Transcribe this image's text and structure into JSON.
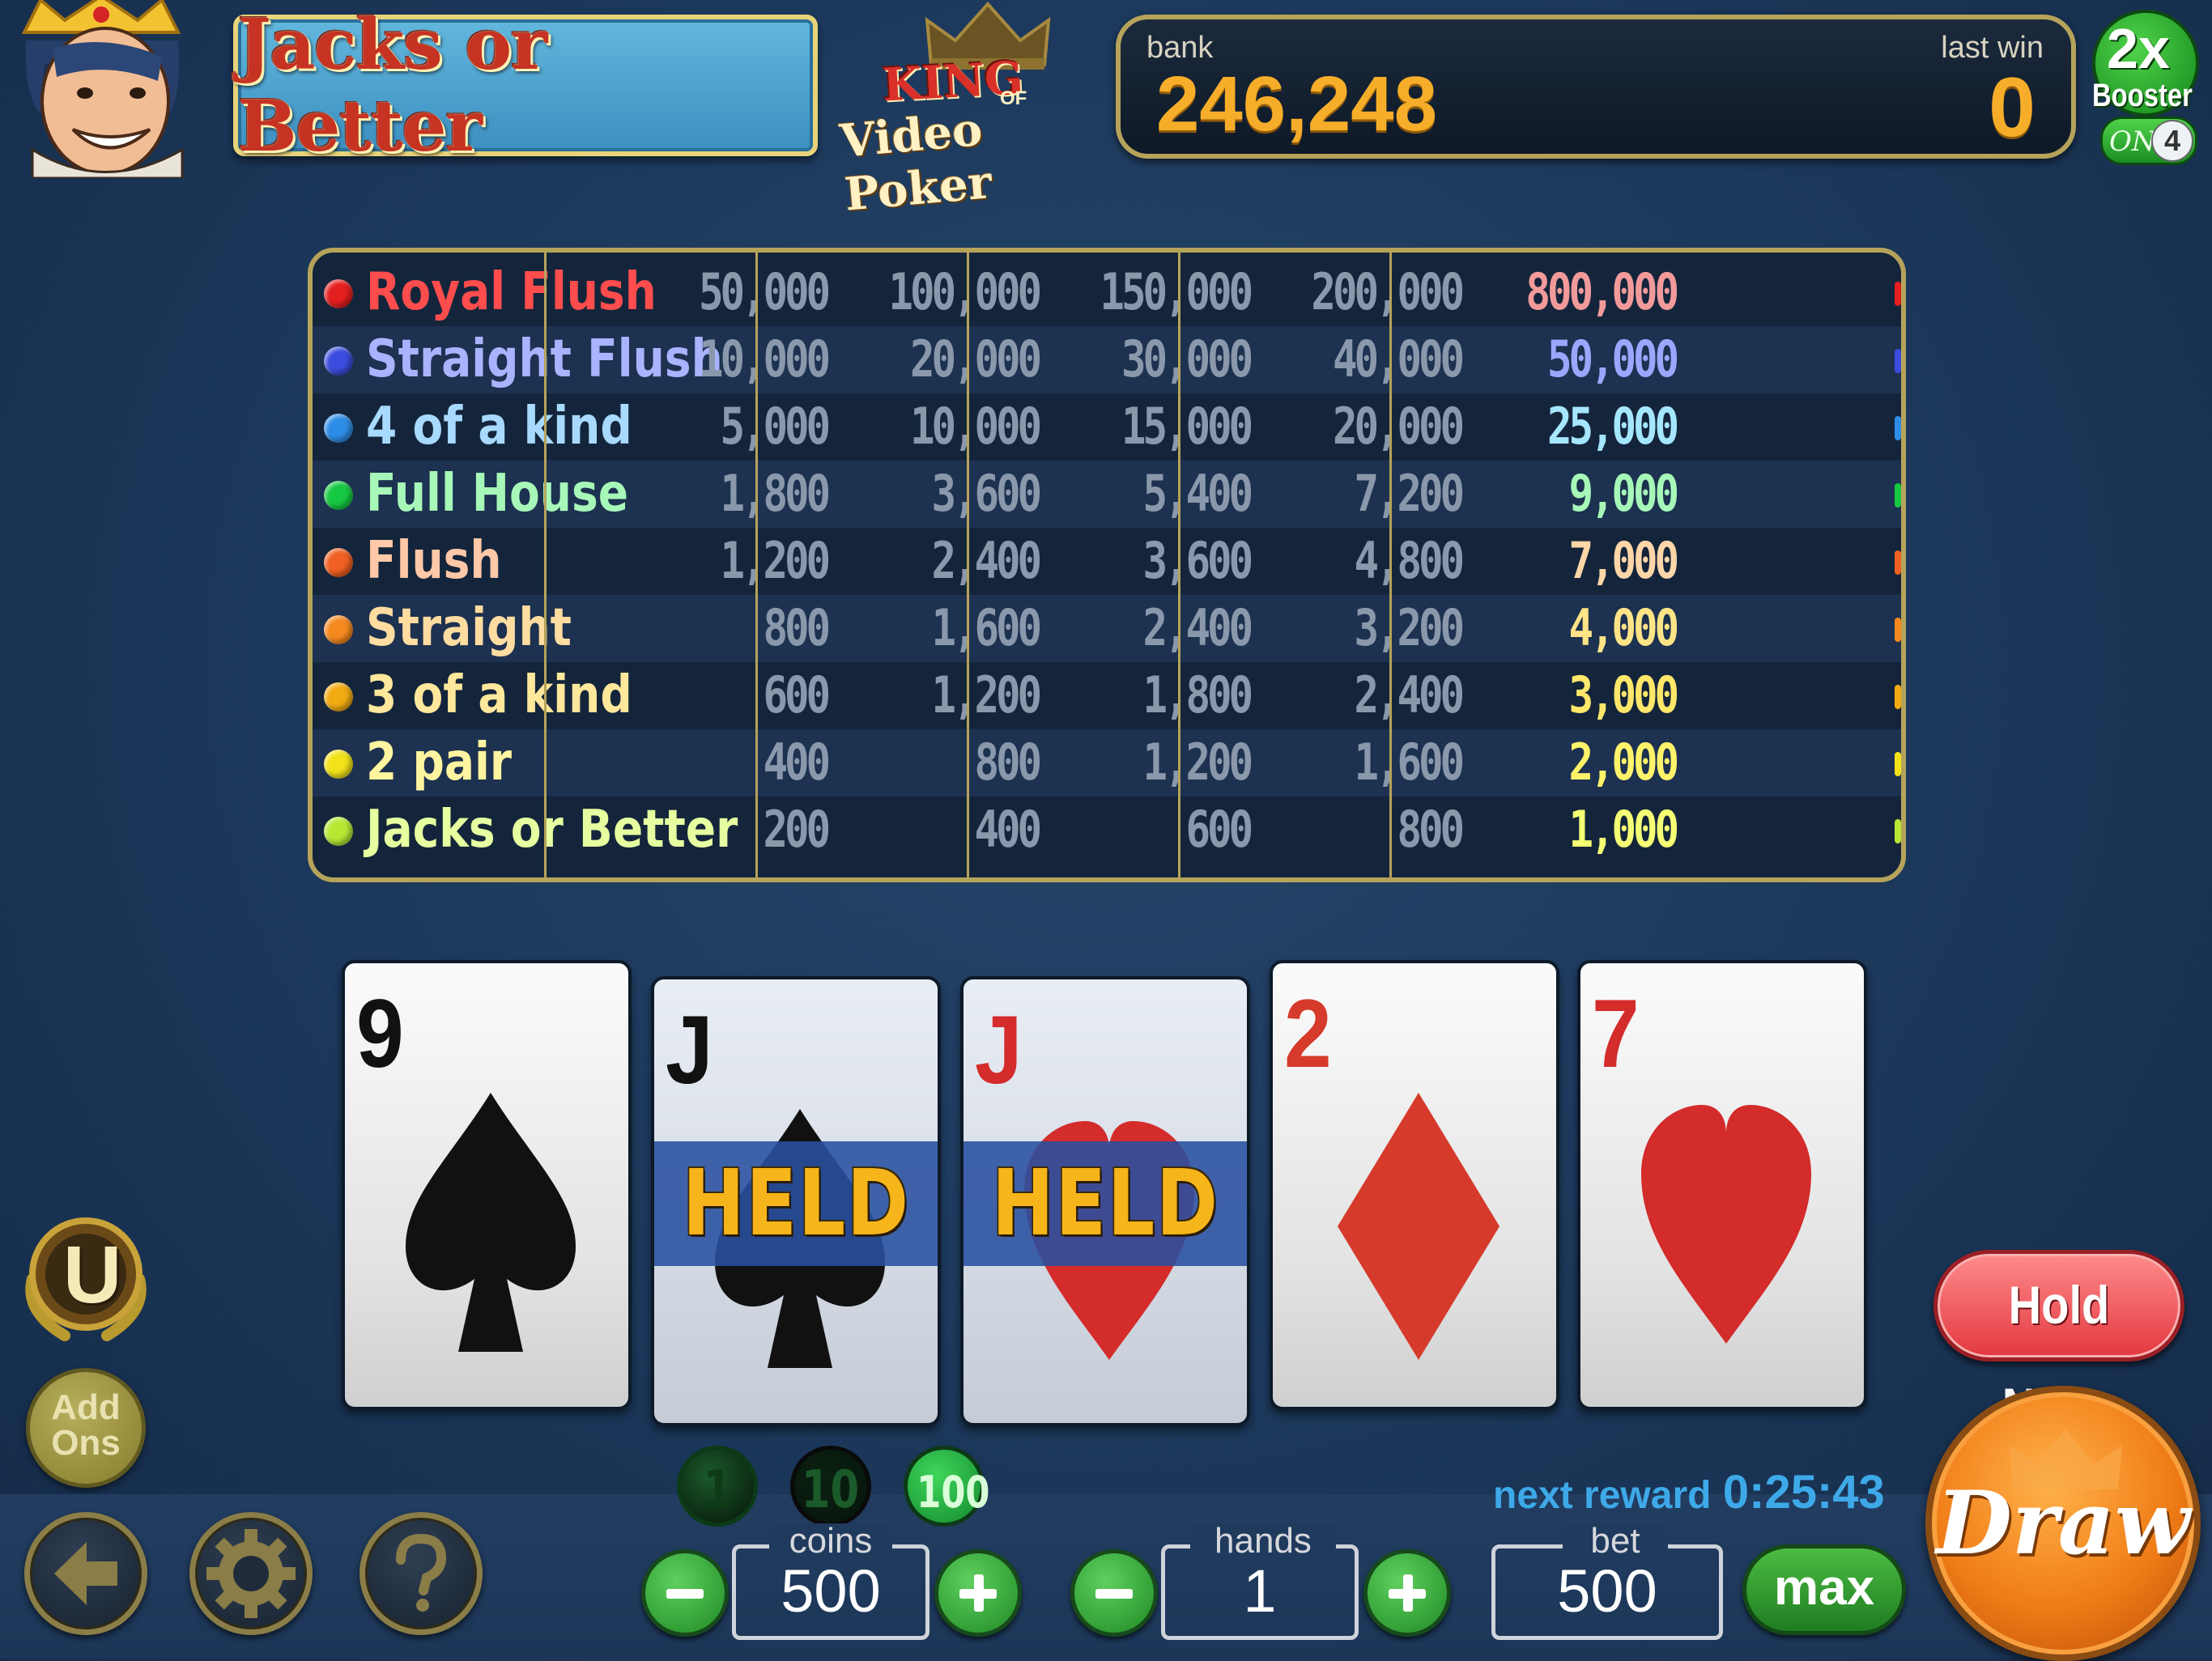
{
  "header": {
    "game_title": "Jacks or Better",
    "logo_line1": "KING",
    "logo_of": "OF",
    "logo_line2": "Video Poker",
    "bank_label": "bank",
    "bank_value": "246,248",
    "last_win_label": "last win",
    "last_win_value": "0",
    "booster_multiplier": "2x",
    "booster_label": "Booster",
    "booster_state": "ON",
    "booster_count": "4"
  },
  "paytable": {
    "rows": [
      {
        "hand": "Royal Flush",
        "color": "#ff4d4d",
        "dot": "#e41f1f",
        "values": [
          "50,000",
          "100,000",
          "150,000",
          "200,000",
          "800,000"
        ],
        "hi": "#f29a9a"
      },
      {
        "hand": "Straight Flush",
        "color": "#a9b3ff",
        "dot": "#3b4dde",
        "values": [
          "10,000",
          "20,000",
          "30,000",
          "40,000",
          "50,000"
        ],
        "hi": "#9ba7ff"
      },
      {
        "hand": "4 of a kind",
        "color": "#a8d9ff",
        "dot": "#2d8de6",
        "values": [
          "5,000",
          "10,000",
          "15,000",
          "20,000",
          "25,000"
        ],
        "hi": "#a5e6ff"
      },
      {
        "hand": "Full House",
        "color": "#a6f7b8",
        "dot": "#16c942",
        "values": [
          "1,800",
          "3,600",
          "5,400",
          "7,200",
          "9,000"
        ],
        "hi": "#a6f7b8"
      },
      {
        "hand": "Flush",
        "color": "#ffc8a8",
        "dot": "#f06022",
        "values": [
          "1,200",
          "2,400",
          "3,600",
          "4,800",
          "7,000"
        ],
        "hi": "#ffd6a8"
      },
      {
        "hand": "Straight",
        "color": "#ffdca0",
        "dot": "#f5891f",
        "values": [
          "800",
          "1,600",
          "2,400",
          "3,200",
          "4,000"
        ],
        "hi": "#ffe487"
      },
      {
        "hand": "3 of a kind",
        "color": "#ffe79b",
        "dot": "#f2aa12",
        "values": [
          "600",
          "1,200",
          "1,800",
          "2,400",
          "3,000"
        ],
        "hi": "#ffe76a"
      },
      {
        "hand": "2 pair",
        "color": "#fff5a0",
        "dot": "#f2e21a",
        "values": [
          "400",
          "800",
          "1,200",
          "1,600",
          "2,000"
        ],
        "hi": "#fff36a"
      },
      {
        "hand": "Jacks or Better",
        "color": "#e6ffa0",
        "dot": "#b6e834",
        "values": [
          "200",
          "400",
          "600",
          "800",
          "1,000"
        ],
        "hi": "#f5ff74"
      }
    ]
  },
  "cards": [
    {
      "rank": "9",
      "suit": "spade",
      "color": "#111111",
      "held": false
    },
    {
      "rank": "J",
      "suit": "spade",
      "color": "#111111",
      "held": true
    },
    {
      "rank": "J",
      "suit": "heart",
      "color": "#d42b2b",
      "held": true
    },
    {
      "rank": "2",
      "suit": "diamond",
      "color": "#d53a2a",
      "held": false
    },
    {
      "rank": "7",
      "suit": "heart",
      "color": "#d42b2b",
      "held": false
    }
  ],
  "held_label": "HELD",
  "side": {
    "u_badge_letter": "U",
    "addons_line1": "Add",
    "addons_line2": "Ons",
    "back_icon": "arrow-left-icon",
    "settings_icon": "gear-icon",
    "help_icon": "question-icon"
  },
  "chips": [
    {
      "value": "1",
      "color": "#1b5a2a",
      "text": "#0e3a18"
    },
    {
      "value": "10",
      "color": "#0b2011",
      "text": "#1b5a2a"
    },
    {
      "value": "100",
      "color": "#27b24a",
      "text": "#d9ffd9"
    }
  ],
  "controls": {
    "coins_label": "coins",
    "coins_value": "500",
    "hands_label": "hands",
    "hands_value": "1",
    "bet_label": "bet",
    "bet_value": "500",
    "max_label": "max",
    "next_reward_label": "next reward",
    "next_reward_time": "0:25:43",
    "hold_none_label": "Hold None",
    "draw_label": "Draw"
  }
}
